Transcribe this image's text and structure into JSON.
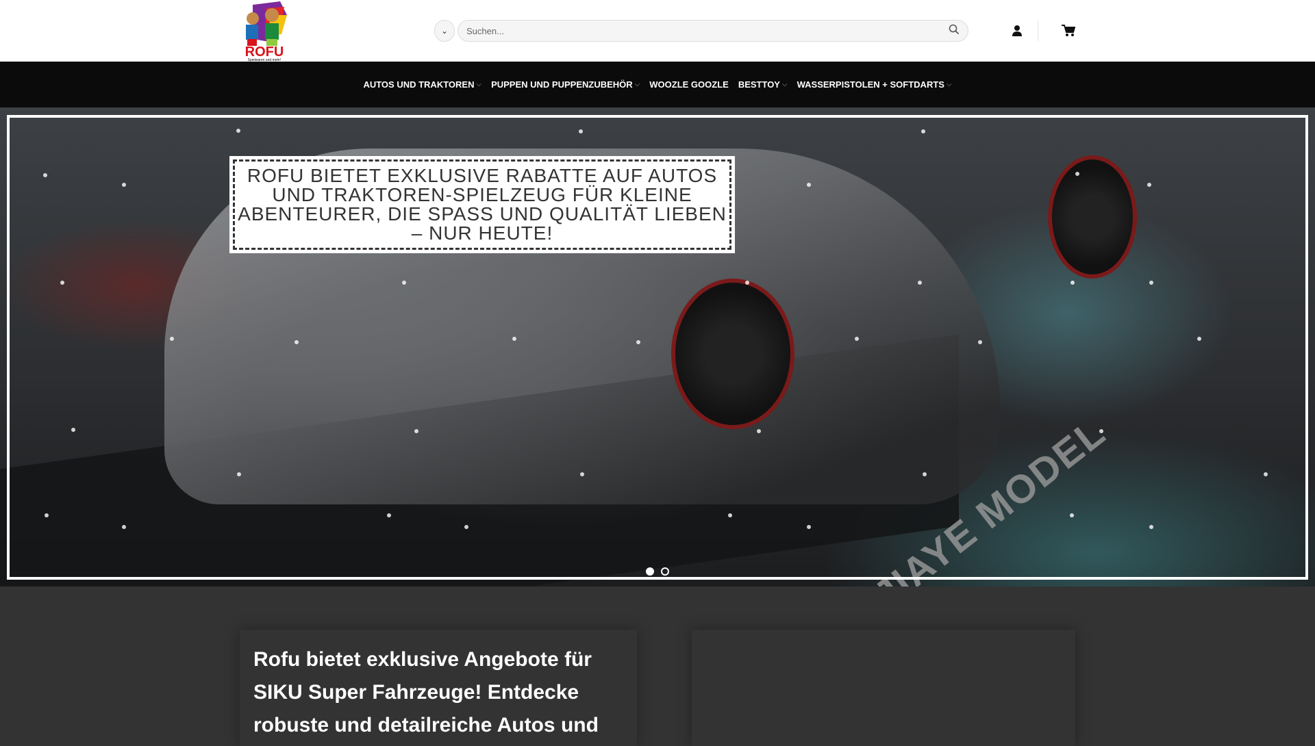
{
  "header": {
    "logo_text": "ROFU",
    "logo_tagline": "Spielwaren und mehr!",
    "search_placeholder": "Suchen..."
  },
  "nav": {
    "items": [
      {
        "label": "AUTOS UND TRAKTOREN",
        "dropdown": true
      },
      {
        "label": "PUPPEN UND PUPPENZUBEHÖR",
        "dropdown": true
      },
      {
        "label": "WOOZLE GOOZLE",
        "dropdown": false
      },
      {
        "label": "BESTTOY",
        "dropdown": true
      },
      {
        "label": "WASSERPISTOLEN + SOFTDARTS",
        "dropdown": true
      }
    ]
  },
  "hero": {
    "caption": "ROFU bietet exklusive Rabatte auf Autos und Traktoren-Spielzeug für kleine Abenteurer, die Spaß und Qualität lieben – nur heute!",
    "image_text": "JIAYE MODEL",
    "slides": 2,
    "active_slide": 1
  },
  "content": {
    "card_text": "Rofu bietet exklusive Angebote für SIKU Super Fahrzeuge! Entdecke robuste und detailreiche Autos und"
  },
  "colors": {
    "nav_bg": "#0b0b0b",
    "content_bg": "#333333",
    "logo_red": "#d9121b"
  }
}
